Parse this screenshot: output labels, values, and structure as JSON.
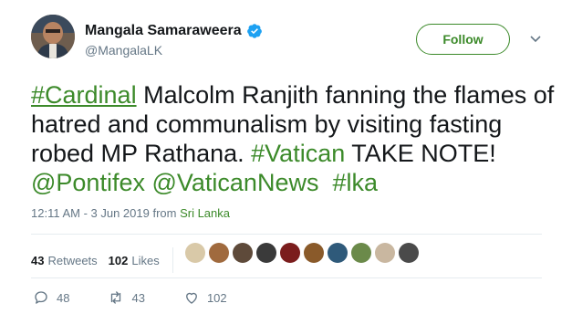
{
  "user": {
    "name": "Mangala Samaraweera",
    "handle": "@MangalaLK",
    "follow_label": "Follow",
    "verified_icon": "verified-badge-icon",
    "avatar_icon": "user-avatar"
  },
  "tweet": {
    "hashtag_cardinal": "#Cardinal",
    "text_1": " Malcolm Ranjith fanning the flames of hatred and communalism by visiting fasting robed MP Rathana. ",
    "hashtag_vatican": "#Vatican",
    "text_2": " TAKE NOTE! ",
    "mention_pontifex": "@Pontifex",
    "mention_vaticannews": "@VaticanNews",
    "hashtag_lka": "#lka"
  },
  "meta": {
    "time": "12:11 AM - 3 Jun 2019 from ",
    "location": "Sri Lanka"
  },
  "stats": {
    "retweets_count": "43",
    "retweets_label": "Retweets",
    "likes_count": "102",
    "likes_label": "Likes"
  },
  "actions": {
    "reply_count": "48",
    "retweet_count": "43",
    "like_count": "102"
  },
  "colors": {
    "accent": "#3c8a2a",
    "muted": "#657786",
    "verified": "#1da1f2"
  }
}
